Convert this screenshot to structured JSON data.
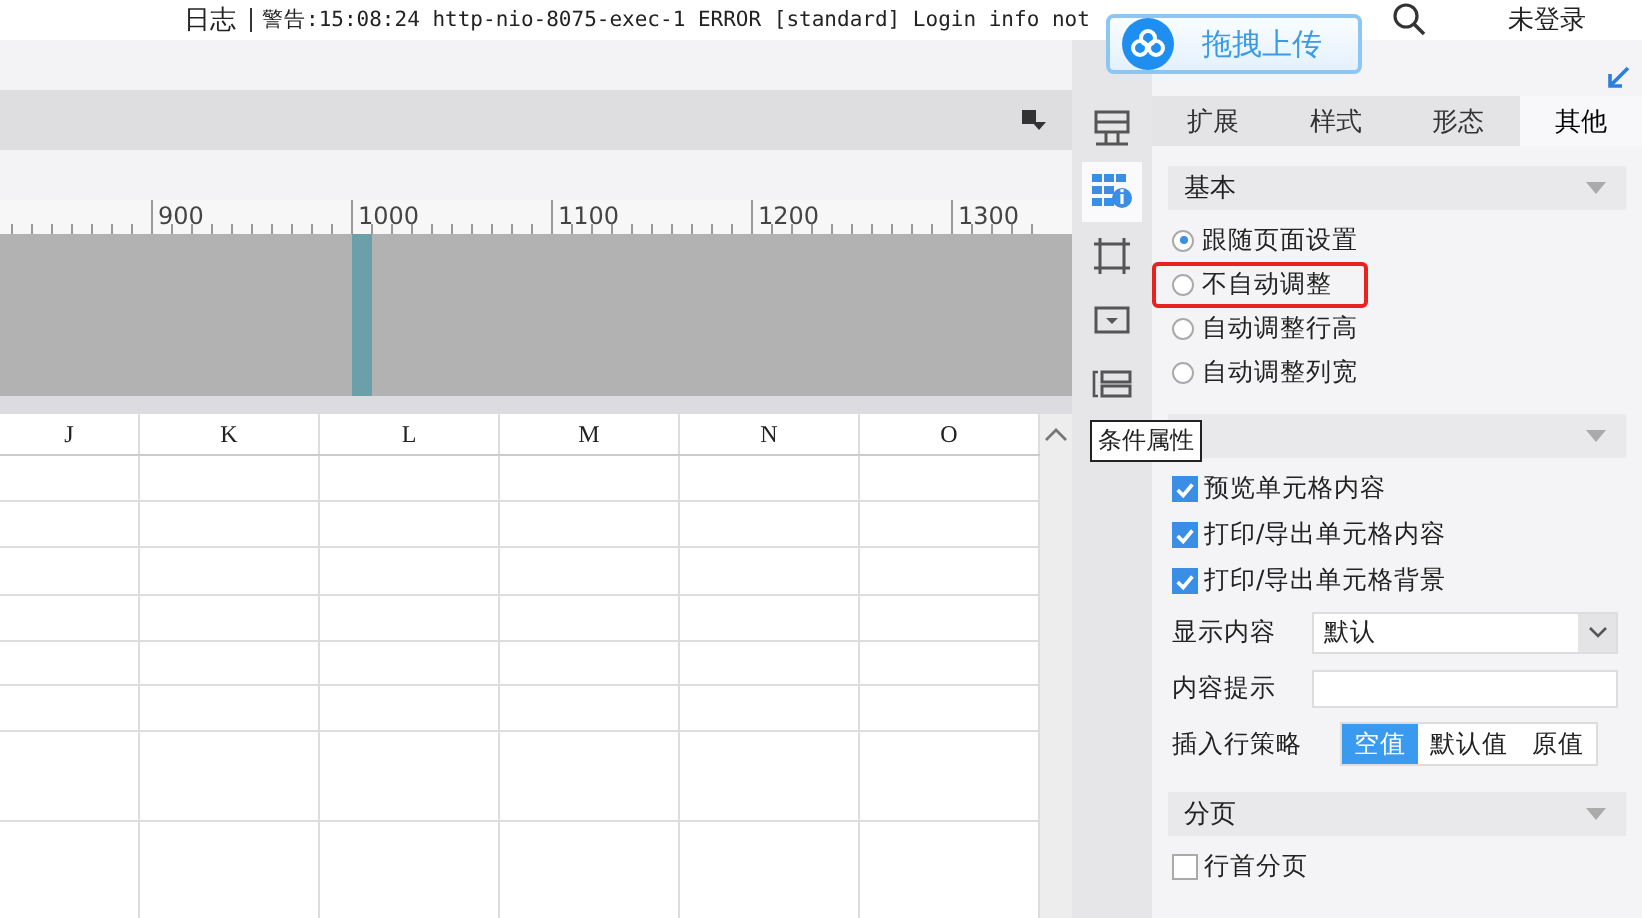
{
  "top_bar": {
    "log_label": "日志",
    "log_message": "警告:15:08:24 http-nio-8075-exec-1 ERROR [standard] Login info not",
    "user": "未登录"
  },
  "upload_badge": {
    "label": "拖拽上传"
  },
  "ruler": {
    "labels": [
      "900",
      "1000",
      "1100",
      "1200",
      "1300"
    ]
  },
  "sheet": {
    "columns": [
      "J",
      "K",
      "L",
      "M",
      "N",
      "O"
    ]
  },
  "side_icons": [
    {
      "kind": "layout",
      "selected": false
    },
    {
      "kind": "grid-info",
      "selected": true
    },
    {
      "kind": "frame",
      "selected": false
    },
    {
      "kind": "dropdown",
      "selected": false
    },
    {
      "kind": "condition",
      "selected": false
    }
  ],
  "tooltip": "条件属性",
  "panel": {
    "tabs": [
      {
        "label": "扩展",
        "selected": false
      },
      {
        "label": "样式",
        "selected": false
      },
      {
        "label": "形态",
        "selected": false
      },
      {
        "label": "其他",
        "selected": true
      }
    ],
    "basic": {
      "title": "基本",
      "options": [
        {
          "label": "跟随页面设置",
          "selected": true
        },
        {
          "label": "不自动调整",
          "selected": false,
          "highlighted": true
        },
        {
          "label": "自动调整行高",
          "selected": false
        },
        {
          "label": "自动调整列宽",
          "selected": false
        }
      ]
    },
    "other": {
      "items": [
        {
          "kind": "checkbox",
          "label": "预览单元格内容",
          "checked": true
        },
        {
          "kind": "checkbox",
          "label": "打印/导出单元格内容",
          "checked": true
        },
        {
          "kind": "checkbox",
          "label": "打印/导出单元格背景",
          "checked": true
        },
        {
          "kind": "select",
          "label": "显示内容",
          "value": "默认"
        },
        {
          "kind": "input",
          "label": "内容提示"
        },
        {
          "kind": "segmented",
          "label": "插入行策略",
          "options": [
            {
              "label": "空值",
              "selected": true
            },
            {
              "label": "默认值",
              "selected": false
            },
            {
              "label": "原值",
              "selected": false
            }
          ]
        }
      ]
    },
    "paging": {
      "title": "分页",
      "items": [
        {
          "kind": "checkbox",
          "label": "行首分页",
          "checked": false
        }
      ]
    }
  }
}
